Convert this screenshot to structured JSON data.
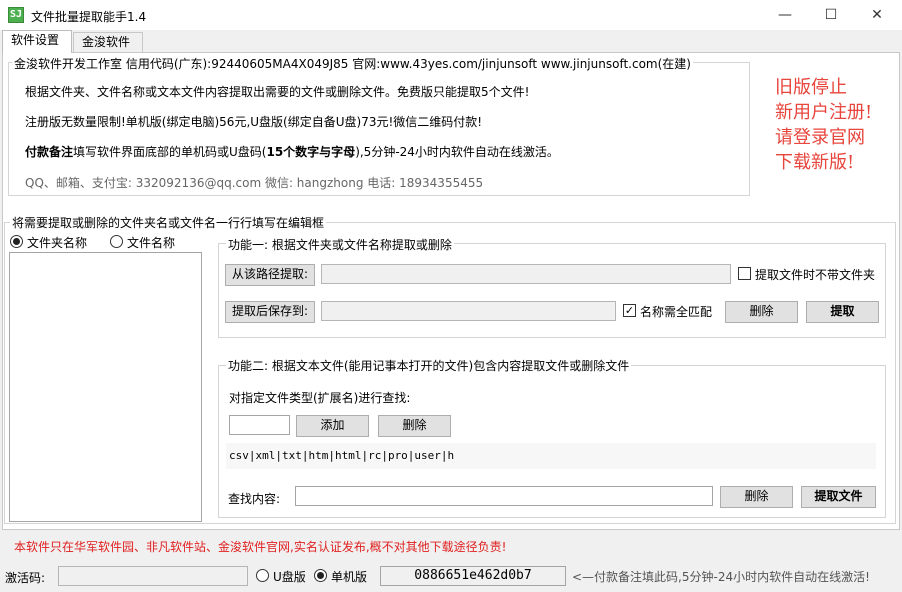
{
  "window": {
    "title": "文件批量提取能手1.4",
    "icon_letters": "SJ",
    "icon_color": "#4caf50",
    "minimize_glyph": "—",
    "maximize_glyph": "☐",
    "close_glyph": "✕"
  },
  "tabs": [
    {
      "label": "软件设置",
      "active": true
    },
    {
      "label": "金浚软件",
      "active": false
    }
  ],
  "info": {
    "group_title": "金浚软件开发工作室 信用代码(广东):92440605MA4X049J85 官网:www.43yes.com/jinjunsoft  www.jinjunsoft.com(在建)",
    "line1": "根据文件夹、文件名称或文本文件内容提取出需要的文件或删除文件。免费版只能提取5个文件!",
    "line2": "注册版无数量限制!单机版(绑定电脑)56元,U盘版(绑定自备U盘)73元!微信二维码付款!",
    "line3_bold": "付款备注",
    "line3_rest": "填写软件界面底部的单机码或U盘码(",
    "line3_bold2": "15个数字与字母",
    "line3_end": "),5分钟-24小时内软件自动在线激活。",
    "contact": "QQ、邮箱、支付宝: 332092136@qq.com  微信: hangzhong  电话: 18934355455"
  },
  "notice": {
    "lines": [
      "旧版停止",
      "新用户注册!",
      "请登录官网",
      "下载新版!"
    ],
    "color": "#e8453c"
  },
  "editor_group": {
    "title": "将需要提取或删除的文件夹名或文件名一行行填写在编辑框",
    "radio_folder": "文件夹名称",
    "radio_file": "文件名称",
    "selected": "folder"
  },
  "func1": {
    "title": "功能一: 根据文件夹或文件名称提取或删除",
    "from_path_button": "从该路径提取:",
    "save_to_button": "提取后保存到:",
    "no_folder_checkbox": "提取文件时不带文件夹",
    "no_folder_checked": false,
    "exact_match_checkbox": "名称需全匹配",
    "exact_match_checked": true,
    "delete_button": "删除",
    "extract_button": "提取"
  },
  "func2": {
    "title": "功能二: 根据文本文件(能用记事本打开的文件)包含内容提取文件或删除文件",
    "type_label": "对指定文件类型(扩展名)进行查找:",
    "add_button": "添加",
    "delete_type_button": "删除",
    "extensions": "csv|xml|txt|htm|html|rc|pro|user|h",
    "search_label": "查找内容:",
    "delete_button": "删除",
    "extract_button": "提取文件"
  },
  "footer": {
    "disclaimer": "本软件只在华军软件园、非凡软件站、金浚软件官网,实名认证发布,概不对其他下载途径负责!",
    "activation_label": "激活码:",
    "radio_usb": "U盘版",
    "radio_pc": "单机版",
    "selected": "pc",
    "machine_code": "0886651e462d0b7",
    "hint": "<—付款备注填此码,5分钟-24小时内软件自动在线激活!"
  }
}
